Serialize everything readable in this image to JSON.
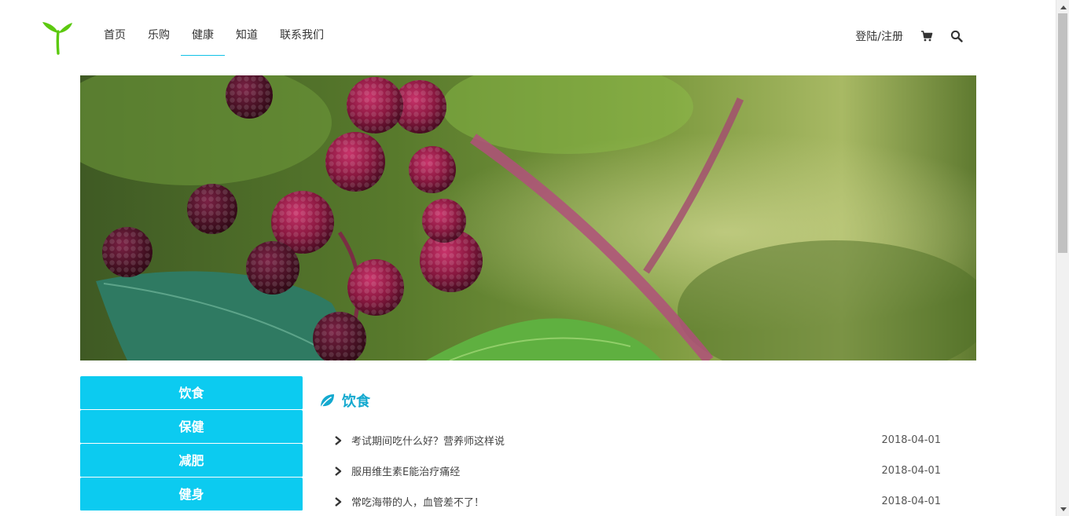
{
  "nav": {
    "items": [
      {
        "label": "首页",
        "active": false
      },
      {
        "label": "乐购",
        "active": false
      },
      {
        "label": "健康",
        "active": true
      },
      {
        "label": "知道",
        "active": false
      },
      {
        "label": "联系我们",
        "active": false
      }
    ]
  },
  "header": {
    "login_label": "登陆/注册",
    "cart_icon": "cart-icon",
    "search_icon": "search-icon"
  },
  "sidebar": {
    "items": [
      {
        "label": "饮食"
      },
      {
        "label": "保健"
      },
      {
        "label": "减肥"
      },
      {
        "label": "健身"
      }
    ]
  },
  "main": {
    "section_title": "饮食",
    "section_icon": "leaf-icon",
    "articles": [
      {
        "title": "考试期间吃什么好？营养师这样说",
        "date": "2018-04-01"
      },
      {
        "title": "服用维生素E能治疗痛经",
        "date": "2018-04-01"
      },
      {
        "title": "常吃海带的人，血管差不了！",
        "date": "2018-04-01"
      }
    ]
  },
  "colors": {
    "accent": "#0ccbf0",
    "title": "#14a9cf",
    "logo": "#5cc90f"
  }
}
